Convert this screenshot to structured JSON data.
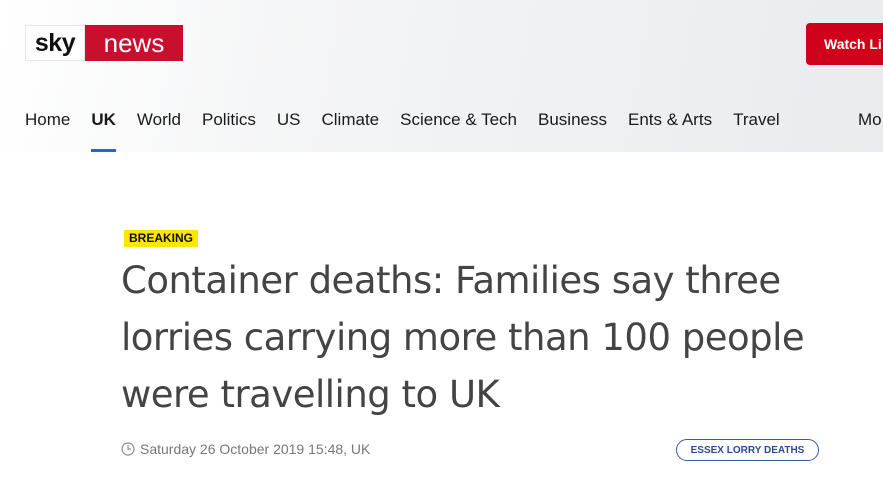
{
  "header": {
    "logo": {
      "sky": "sky",
      "news": "news"
    },
    "watch_live_label": "Watch Li"
  },
  "nav": {
    "items": [
      "Home",
      "UK",
      "World",
      "Politics",
      "US",
      "Climate",
      "Science & Tech",
      "Business",
      "Ents & Arts",
      "Travel"
    ],
    "active": "UK",
    "more_label": "Mo"
  },
  "article": {
    "badge": "BREAKING",
    "headline": "Container deaths: Families say three lorries carrying more than 100 people were travelling to UK",
    "timestamp": "Saturday 26 October 2019 15:48, UK",
    "tag": "ESSEX LORRY DEATHS"
  },
  "colors": {
    "brand_red": "#c8102e",
    "watch_live_red": "#d0021b",
    "breaking_yellow": "#ffe600",
    "active_underline": "#2b63cc",
    "tag_blue": "#3a59a8"
  },
  "icons": {
    "timestamp_icon": "clock-icon"
  }
}
